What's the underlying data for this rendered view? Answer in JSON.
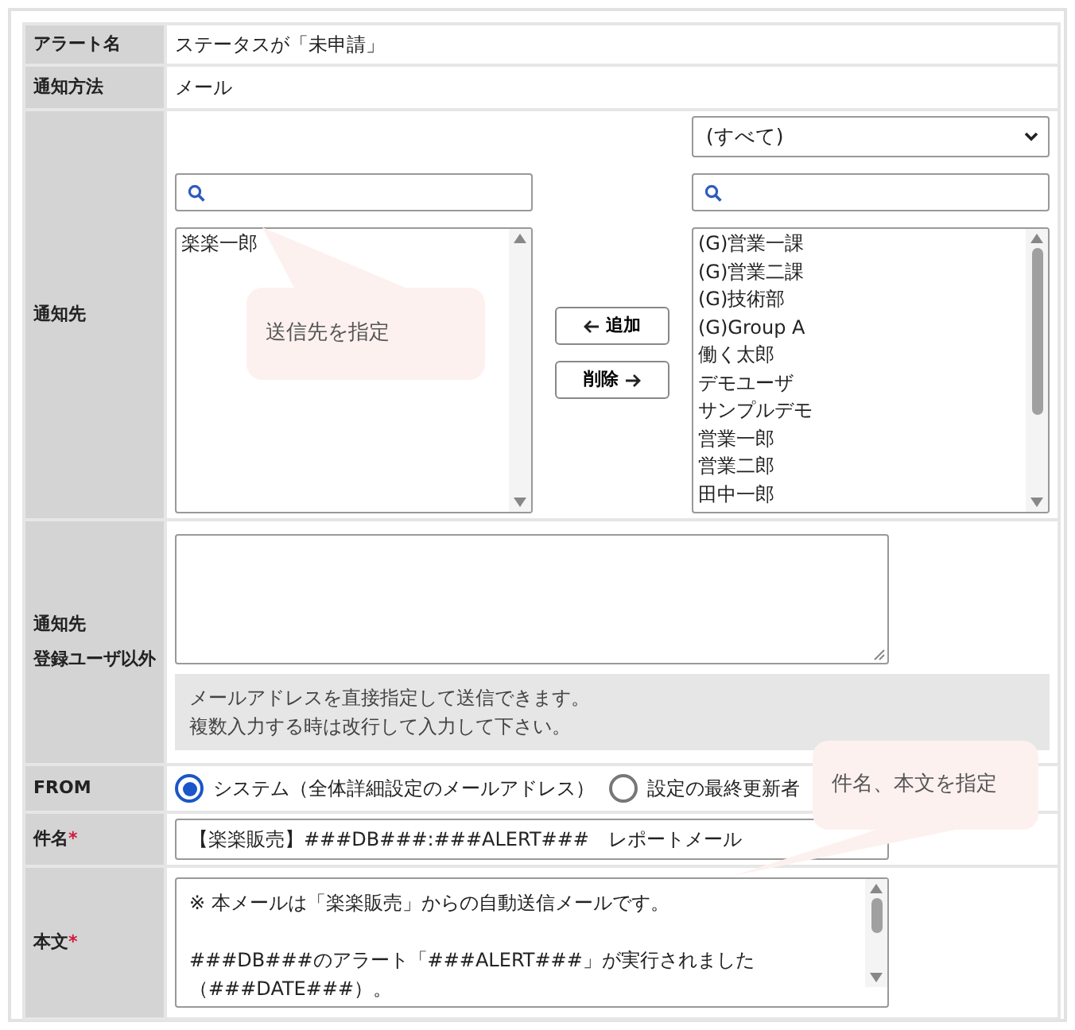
{
  "alert_name": {
    "label": "アラート名",
    "value": "ステータスが「未申請」"
  },
  "notify_method": {
    "label": "通知方法",
    "value": "メール"
  },
  "recipients": {
    "label": "通知先",
    "filter": {
      "value": "(すべて)"
    },
    "selected_list": {
      "items": [
        {
          "text": "楽楽一郎",
          "selected": false
        }
      ]
    },
    "available_list": {
      "items": [
        {
          "text": "(G)営業一課",
          "selected": false
        },
        {
          "text": "(G)営業二課",
          "selected": false
        },
        {
          "text": "(G)技術部",
          "selected": false
        },
        {
          "text": "(G)Group A",
          "selected": false
        },
        {
          "text": "働く太郎",
          "selected": false
        },
        {
          "text": "デモユーザ",
          "selected": false
        },
        {
          "text": "サンプルデモ",
          "selected": false
        },
        {
          "text": "営業一郎",
          "selected": false
        },
        {
          "text": "営業二郎",
          "selected": false
        },
        {
          "text": "田中一郎",
          "selected": false
        }
      ]
    },
    "add_button": "追加",
    "remove_button": "削除"
  },
  "external": {
    "label_lines": [
      "通知先",
      "登録ユーザ以外"
    ],
    "help_lines": [
      "メールアドレスを直接指定して送信できます。",
      "複数入力する時は改行して入力して下さい。"
    ]
  },
  "from": {
    "label": "FROM",
    "options": [
      {
        "text": "システム（全体詳細設定のメールアドレス）",
        "selected": true
      },
      {
        "text": "設定の最終更新者",
        "selected": false
      }
    ]
  },
  "subject": {
    "label": "件名",
    "required_mark": "*",
    "value": "【楽楽販売】###DB###:###ALERT###　レポートメール"
  },
  "body": {
    "label": "本文",
    "required_mark": "*",
    "paragraphs": [
      {
        "lines": [
          "※ 本メールは「楽楽販売」からの自動送信メールです。"
        ]
      },
      {
        "lines": [
          "###DB###のアラート「###ALERT###」が実行されました",
          "（###DATE###）。"
        ]
      }
    ]
  },
  "callouts": [
    {
      "text": "送信先を指定",
      "kind": "recipients"
    },
    {
      "text": "件名、本文を指定",
      "kind": "subject"
    }
  ]
}
